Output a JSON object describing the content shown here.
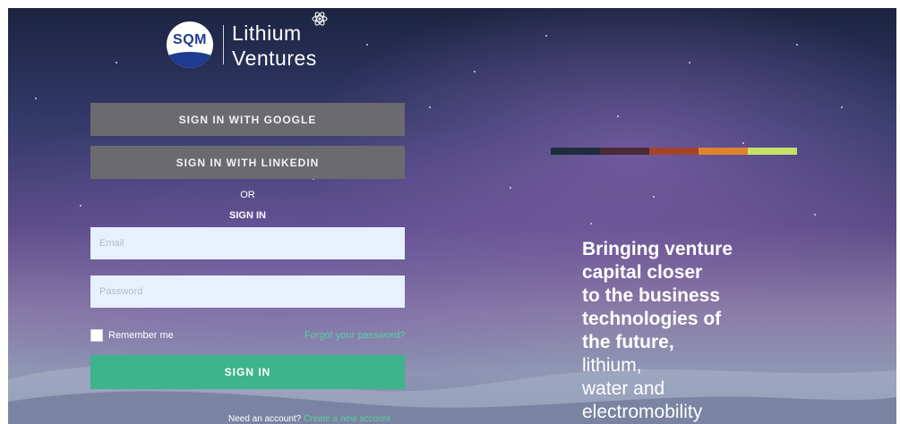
{
  "brand": {
    "logo_mark": "SQM",
    "name_line1": "Lithium",
    "name_line2": "Ventures",
    "badge_icon": "atom-icon"
  },
  "login": {
    "google_button": "SIGN IN WITH GOOGLE",
    "linkedin_button": "SIGN IN WITH LINKEDIN",
    "or_text": "OR",
    "signin_heading": "SIGN IN",
    "email_placeholder": "Email",
    "email_value": "",
    "password_placeholder": "Password",
    "password_value": "",
    "remember_label": "Remember me",
    "remember_checked": false,
    "forgot_link": "Forgot your password?",
    "submit_button": "SIGN IN",
    "need_account_text": "Need an account?",
    "create_account_link": "Create a new account"
  },
  "hero": {
    "color_stripes": [
      "#1d2e3a",
      "#4b2a3a",
      "#a2442c",
      "#e0832d",
      "#c6e06a"
    ],
    "tagline_bold": [
      "Bringing venture",
      "capital closer",
      "to the business",
      "technologies of",
      "the future,"
    ],
    "tagline_light": [
      "lithium,",
      "water and",
      "electromobility"
    ]
  },
  "colors": {
    "primary_green": "#3db48b",
    "social_button_gray": "#6b6a6f",
    "link_green": "#5ad1a0"
  }
}
